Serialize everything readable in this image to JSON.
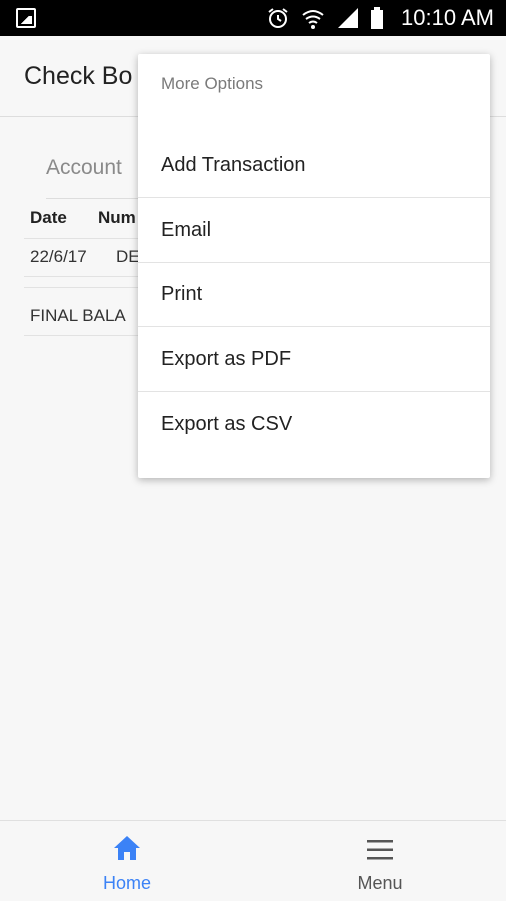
{
  "status_bar": {
    "time": "10:10 AM",
    "icons": [
      "gallery-icon",
      "alarm-icon",
      "wifi-icon",
      "signal-icon",
      "battery-icon"
    ]
  },
  "app_bar": {
    "title": "Check Bo"
  },
  "account": {
    "label": "Account"
  },
  "table": {
    "headers": [
      "Date",
      "Num"
    ],
    "rows": [
      {
        "date": "22/6/17",
        "num": "DE"
      }
    ],
    "final_label": "FINAL BALA"
  },
  "menu": {
    "title": "More Options",
    "items": [
      "Add Transaction",
      "Email",
      "Print",
      "Export as PDF",
      "Export as CSV"
    ]
  },
  "bottom_nav": {
    "home_label": "Home",
    "menu_label": "Menu",
    "active_color": "#3b82f6",
    "inactive_color": "#555555"
  }
}
